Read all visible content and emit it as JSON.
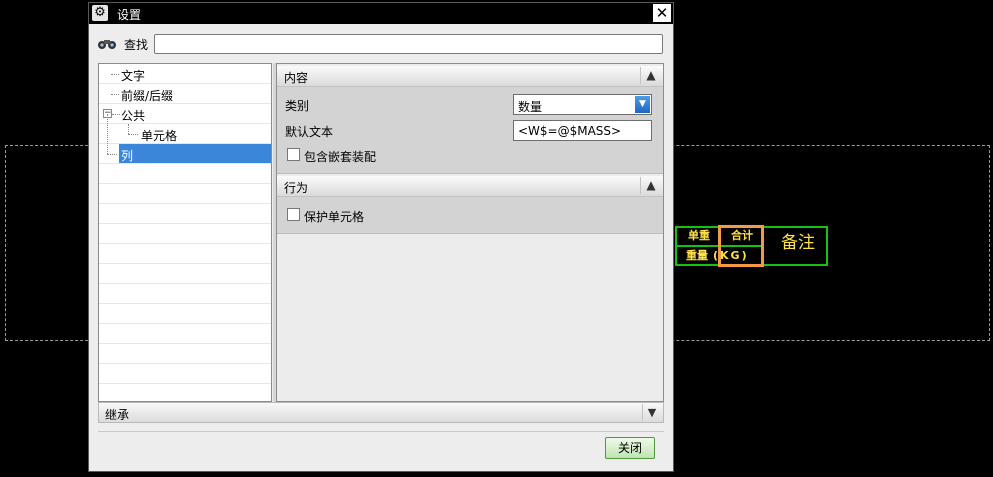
{
  "dialog": {
    "title": "设置",
    "close_symbol": "✕"
  },
  "find": {
    "label": "查找",
    "value": "",
    "icon": "binoculars-icon"
  },
  "tree": {
    "items": [
      {
        "label": "文字"
      },
      {
        "label": "前缀/后缀"
      },
      {
        "label": "公共",
        "expander": "−"
      },
      {
        "label": "单元格"
      },
      {
        "label": "列",
        "selected": true
      }
    ]
  },
  "sections": {
    "content": {
      "title": "内容",
      "category_label": "类别",
      "category_value": "数量",
      "default_text_label": "默认文本",
      "default_text_value": "<W$=@$MASS>",
      "include_nested_label": "包含嵌套装配"
    },
    "behavior": {
      "title": "行为",
      "protect_cell_label": "保护单元格"
    },
    "inherit": {
      "title": "继承"
    }
  },
  "buttons": {
    "close_label": "关闭"
  },
  "drawing": {
    "unit_weight": "单重",
    "total": "合计",
    "weight": "重量",
    "kg": "(KG)",
    "remark": "备注"
  },
  "colors": {
    "selection": "#3b86d8",
    "table_line": "#13c313",
    "table_text": "#ffe14a",
    "highlight_box": "#f49a45"
  }
}
